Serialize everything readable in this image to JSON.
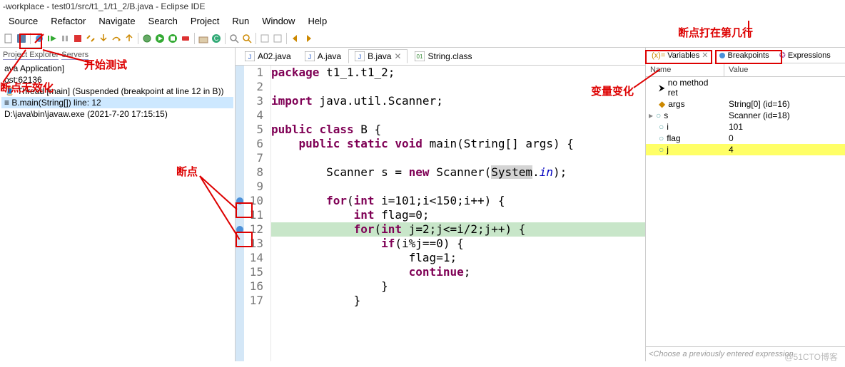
{
  "window": {
    "title": "-workplace - test01/src/t1_1/t1_2/B.java - Eclipse IDE"
  },
  "menu": [
    "Source",
    "Refactor",
    "Navigate",
    "Search",
    "Project",
    "Run",
    "Window",
    "Help"
  ],
  "panes": {
    "explorer_tab1": "Project Explorer",
    "explorer_tab2": "Servers"
  },
  "debug": {
    "app": "ava Application]",
    "host": "ost:62136",
    "thread": "Thread [main] (Suspended (breakpoint at line 12 in B))",
    "frame": "B.main(String[]) line: 12",
    "terminated": "D:\\java\\bin\\javaw.exe (2021-7-20 17:15:15)"
  },
  "tabs": [
    {
      "label": "A02.java",
      "active": false
    },
    {
      "label": "A.java",
      "active": false
    },
    {
      "label": "B.java",
      "active": true
    },
    {
      "label": "String.class",
      "active": false
    }
  ],
  "code": {
    "lines": [
      {
        "n": 1,
        "segs": [
          [
            "kw",
            "package"
          ],
          [
            "",
            " t1_1.t1_2;"
          ]
        ]
      },
      {
        "n": 2,
        "segs": []
      },
      {
        "n": 3,
        "segs": [
          [
            "kw",
            "import"
          ],
          [
            "",
            " java.util.Scanner;"
          ]
        ]
      },
      {
        "n": 4,
        "segs": []
      },
      {
        "n": 5,
        "segs": [
          [
            "kw",
            "public"
          ],
          [
            "",
            " "
          ],
          [
            "kw",
            "class"
          ],
          [
            "",
            " B {"
          ]
        ]
      },
      {
        "n": 6,
        "segs": [
          [
            "",
            "    "
          ],
          [
            "kw",
            "public"
          ],
          [
            "",
            " "
          ],
          [
            "kw",
            "static"
          ],
          [
            "",
            " "
          ],
          [
            "kw",
            "void"
          ],
          [
            "",
            " main(String[] args) {"
          ]
        ]
      },
      {
        "n": 7,
        "segs": []
      },
      {
        "n": 8,
        "segs": [
          [
            "",
            "        Scanner s = "
          ],
          [
            "kw",
            "new"
          ],
          [
            "",
            " Scanner("
          ],
          [
            "hl-sys",
            "System"
          ],
          [
            "",
            "."
          ],
          [
            "static-it",
            "in"
          ],
          [
            "",
            ");"
          ]
        ]
      },
      {
        "n": 9,
        "segs": []
      },
      {
        "n": 10,
        "bp": true,
        "segs": [
          [
            "",
            "        "
          ],
          [
            "kw",
            "for"
          ],
          [
            "",
            "("
          ],
          [
            "kw",
            "int"
          ],
          [
            "",
            " i=101;i<150;i++) {"
          ]
        ]
      },
      {
        "n": 11,
        "segs": [
          [
            "",
            "            "
          ],
          [
            "kw",
            "int"
          ],
          [
            "",
            " flag=0;"
          ]
        ]
      },
      {
        "n": 12,
        "bp": true,
        "hl": true,
        "segs": [
          [
            "",
            "            "
          ],
          [
            "kw",
            "for"
          ],
          [
            "",
            "("
          ],
          [
            "kw",
            "int"
          ],
          [
            "",
            " j=2;j<=i/2;j++) {"
          ]
        ]
      },
      {
        "n": 13,
        "segs": [
          [
            "",
            "                "
          ],
          [
            "kw",
            "if"
          ],
          [
            "",
            "(i%j==0) {"
          ]
        ]
      },
      {
        "n": 14,
        "segs": [
          [
            "",
            "                    flag=1;"
          ]
        ]
      },
      {
        "n": 15,
        "segs": [
          [
            "",
            "                    "
          ],
          [
            "kw",
            "continue"
          ],
          [
            "",
            ";"
          ]
        ]
      },
      {
        "n": 16,
        "segs": [
          [
            "",
            "                }"
          ]
        ]
      },
      {
        "n": 17,
        "segs": [
          [
            "",
            "            }"
          ]
        ]
      }
    ]
  },
  "variables": {
    "tabs": [
      {
        "label": "Variables",
        "icon": "var"
      },
      {
        "label": "Breakpoints",
        "icon": "bp"
      },
      {
        "label": "Expressions",
        "icon": "expr"
      }
    ],
    "cols": {
      "name": "Name",
      "value": "Value"
    },
    "rows": [
      {
        "icon": "info",
        "name": "no method ret",
        "value": ""
      },
      {
        "icon": "arg",
        "name": "args",
        "value": "String[0]  (id=16)"
      },
      {
        "icon": "local",
        "name": "s",
        "value": "Scanner  (id=18)",
        "expand": true
      },
      {
        "icon": "local",
        "name": "i",
        "value": "101"
      },
      {
        "icon": "local",
        "name": "flag",
        "value": "0"
      },
      {
        "icon": "local",
        "name": "j",
        "value": "4",
        "hl": true
      }
    ],
    "footer": "<Choose a previously entered expression"
  },
  "annotations": {
    "a1": "断点打在第几行",
    "a2": "开始测试",
    "a3": "断点无效化",
    "a4": "变量变化",
    "a5": "断点"
  },
  "watermark": "@51CTO博客"
}
